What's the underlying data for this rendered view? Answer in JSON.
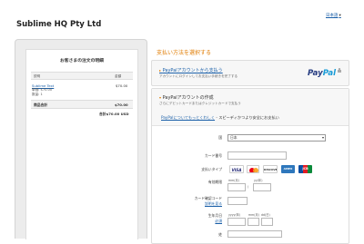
{
  "header": {
    "language": "日本語",
    "language_arrow": "▾",
    "merchant": "Sublime HQ Pty Ltd"
  },
  "summary": {
    "title": "お客さまの注文の明細",
    "col_description": "説明",
    "col_amount": "金額",
    "item_name": "Sublime Text",
    "item_unit_price": "単価: $70.00",
    "item_quantity": "数量: 1",
    "item_amount": "$70.00",
    "subtotal_label": "商品合計",
    "subtotal_value": "$70.00",
    "total": "合計$70.00 USD"
  },
  "payment": {
    "choose_title": "支払い方法を選択する",
    "paypal_login_link": "PayPalアカウントから支払う",
    "paypal_login_sub": "アカウントにログインしてお支払い手続きを完了する",
    "paypal_logo_1": "Pay",
    "paypal_logo_2": "Pal",
    "create_title": "PayPalアカウントの作成",
    "create_sub": "さらにデビットカードまたはクレジットカードで支払う",
    "more_link": "PayPalについてもっとくわしく",
    "more_rest": " - スピーディかつより安全にお支払い"
  },
  "form": {
    "country_label": "国",
    "country_value": "日本",
    "card_number_label": "カード番号",
    "card_type_label": "支払いタイプ",
    "expiry_label": "有効期限",
    "expiry_month_hint": "mm(月)",
    "expiry_year_hint": "yy(年)",
    "cvv_label": "カード確認コード",
    "cvv_help": "説明を見る",
    "birth_label": "生年月日",
    "birth_required": "必須",
    "birth_hint_year": "yyyy(年)",
    "birth_hint_month": "mm(月)",
    "birth_hint_day": "dd(日)",
    "surname_label": "姓",
    "cards": {
      "visa": "VISA",
      "discover": "DISCOVER",
      "amex": "AMEX",
      "jcb": "JCB"
    }
  },
  "colors": {
    "accent_orange": "#e07b00",
    "link_blue": "#1a5fa8",
    "paypal_navy": "#253b80",
    "paypal_light": "#179bd7"
  }
}
